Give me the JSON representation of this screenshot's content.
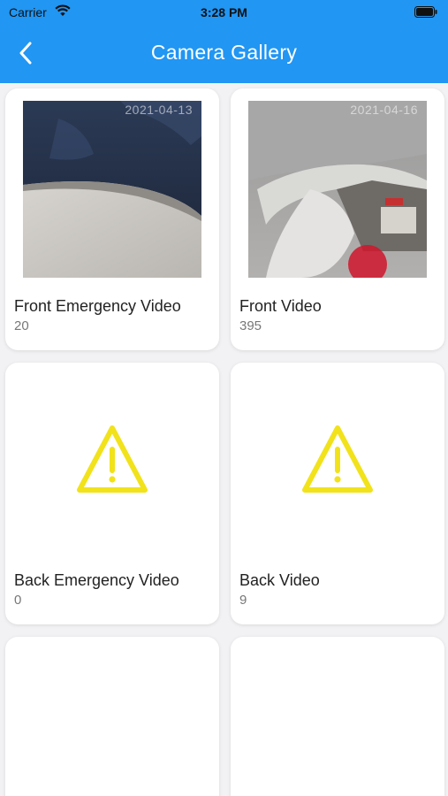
{
  "status_bar": {
    "carrier": "Carrier",
    "time": "3:28 PM"
  },
  "header": {
    "title": "Camera Gallery",
    "back_icon": "chevron-left-icon"
  },
  "colors": {
    "accent": "#2196f3",
    "warning": "#f1e21b"
  },
  "gallery": [
    {
      "label": "Front Emergency Video",
      "count": "20",
      "date": "2021-04-13",
      "preview": "image"
    },
    {
      "label": "Front Video",
      "count": "395",
      "date": "2021-04-16",
      "preview": "image"
    },
    {
      "label": "Back Emergency Video",
      "count": "0",
      "preview": "warning-icon"
    },
    {
      "label": "Back Video",
      "count": "9",
      "preview": "warning-icon"
    }
  ]
}
